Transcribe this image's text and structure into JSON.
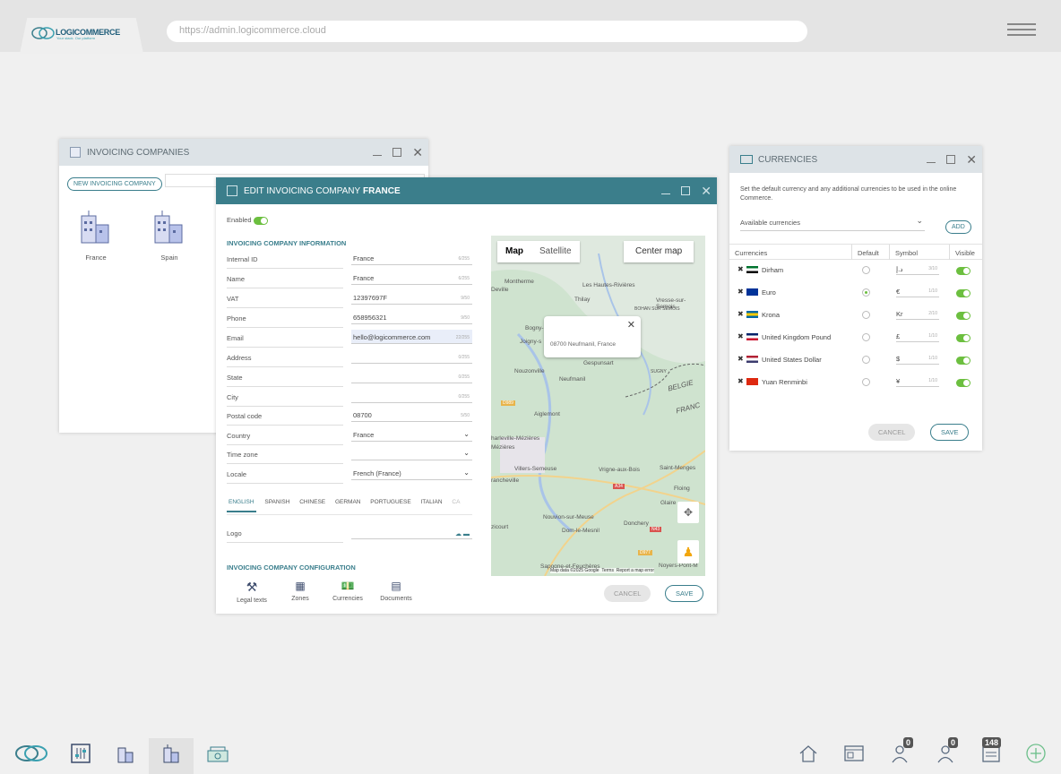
{
  "app": {
    "logo_text": "LOGICOMMERCE",
    "logo_sub": "Your stack. Our platform",
    "url": "https://admin.logicommerce.cloud",
    "accent": "#3b7e8b"
  },
  "invoicing_companies": {
    "title": "INVOICING COMPANIES",
    "new_button": "NEW INVOICING COMPANY",
    "companies": [
      {
        "name": "France"
      },
      {
        "name": "Spain"
      }
    ]
  },
  "edit": {
    "title_prefix": "EDIT INVOICING COMPANY",
    "title_name": "FRANCE",
    "enabled_label": "Enabled",
    "section_info": "INVOICING COMPANY INFORMATION",
    "fields": [
      {
        "label": "Internal ID",
        "value": "France",
        "count": "6/255"
      },
      {
        "label": "Name",
        "value": "France",
        "count": "6/255"
      },
      {
        "label": "VAT",
        "value": "12397697F",
        "count": "9/50"
      },
      {
        "label": "Phone",
        "value": "658956321",
        "count": "9/50"
      },
      {
        "label": "Email",
        "value": "hello@logicommerce.com",
        "count": "22/255"
      },
      {
        "label": "Address",
        "value": "",
        "count": "0/255"
      },
      {
        "label": "State",
        "value": "",
        "count": "0/255"
      },
      {
        "label": "City",
        "value": "",
        "count": "0/255"
      },
      {
        "label": "Postal code",
        "value": "08700",
        "count": "5/50"
      },
      {
        "label": "Country",
        "value": "France",
        "count": ""
      },
      {
        "label": "Time zone",
        "value": "",
        "count": ""
      },
      {
        "label": "Locale",
        "value": "French (France)",
        "count": ""
      }
    ],
    "languages": [
      "ENGLISH",
      "SPANISH",
      "CHINESE",
      "GERMAN",
      "PORTUGUESE",
      "ITALIAN",
      "CA"
    ],
    "logo_label": "Logo",
    "section_config": "INVOICING COMPANY CONFIGURATION",
    "config_items": [
      {
        "label": "Legal texts",
        "icon": "gavel-icon"
      },
      {
        "label": "Zones",
        "icon": "map-icon"
      },
      {
        "label": "Currencies",
        "icon": "money-icon"
      },
      {
        "label": "Documents",
        "icon": "document-icon"
      }
    ],
    "cancel": "CANCEL",
    "save": "SAVE"
  },
  "map": {
    "tab_map": "Map",
    "tab_satellite": "Satellite",
    "center": "Center map",
    "popup": "08700 Neufmanil, France",
    "places": [
      "Montherme",
      "Les Hautes-Rivières",
      "Thilay",
      "Vresse-sur-Semois",
      "Deville",
      "BOHAN SUR SEMOIS",
      "Bogny-",
      "Joigny-s",
      "Gespunsart",
      "Nouzonville",
      "Neufmanil",
      "SUGNY",
      "BELGIE",
      "FRANC",
      "Aiglemont",
      "harleville-Mézières",
      "Mézières",
      "Villers-Semeuse",
      "Vrigne-aux-Bois",
      "Saint-Menges",
      "rancheville",
      "Floing",
      "Glaire",
      "Nouvion-sur-Meuse",
      "Donchery",
      "zicourt",
      "Dom-le-Mesnil",
      "Noyers-Pont-M",
      "Sapogne-et-Feuchères"
    ],
    "roads": [
      "D989",
      "A34",
      "N43",
      "D977"
    ],
    "attribution": [
      "Map data ©2025 Google",
      "Terms",
      "Report a map error"
    ]
  },
  "currencies": {
    "title": "CURRENCIES",
    "description": "Set the default currency and any additional currencies to be used in the online Commerce.",
    "available_label": "Available currencies",
    "add": "ADD",
    "headers": [
      "Currencies",
      "Default",
      "Symbol",
      "Visible"
    ],
    "rows": [
      {
        "name": "Dirham",
        "symbol": "د.إ",
        "count": "3/10",
        "default": false,
        "flag": "ae"
      },
      {
        "name": "Euro",
        "symbol": "€",
        "count": "1/10",
        "default": true,
        "flag": "eu"
      },
      {
        "name": "Krona",
        "symbol": "Kr",
        "count": "2/10",
        "default": false,
        "flag": "se"
      },
      {
        "name": "United Kingdom Pound",
        "symbol": "£",
        "count": "1/10",
        "default": false,
        "flag": "gb"
      },
      {
        "name": "United States Dollar",
        "symbol": "$",
        "count": "1/10",
        "default": false,
        "flag": "us"
      },
      {
        "name": "Yuan Renminbi",
        "symbol": "¥",
        "count": "1/10",
        "default": false,
        "flag": "cn"
      }
    ],
    "cancel": "CANCEL",
    "save": "SAVE"
  },
  "bottombar": {
    "left_icons": [
      "logicommerce-icon",
      "settings-sliders-icon",
      "buildings-icon",
      "invoicing-company-icon",
      "money-icon"
    ],
    "right_icons": [
      "home-icon",
      "dashboard-icon",
      "user-icon",
      "users-icon",
      "orders-icon",
      "add-icon"
    ],
    "badges": {
      "user": "0",
      "users": "0",
      "orders": "148"
    }
  }
}
